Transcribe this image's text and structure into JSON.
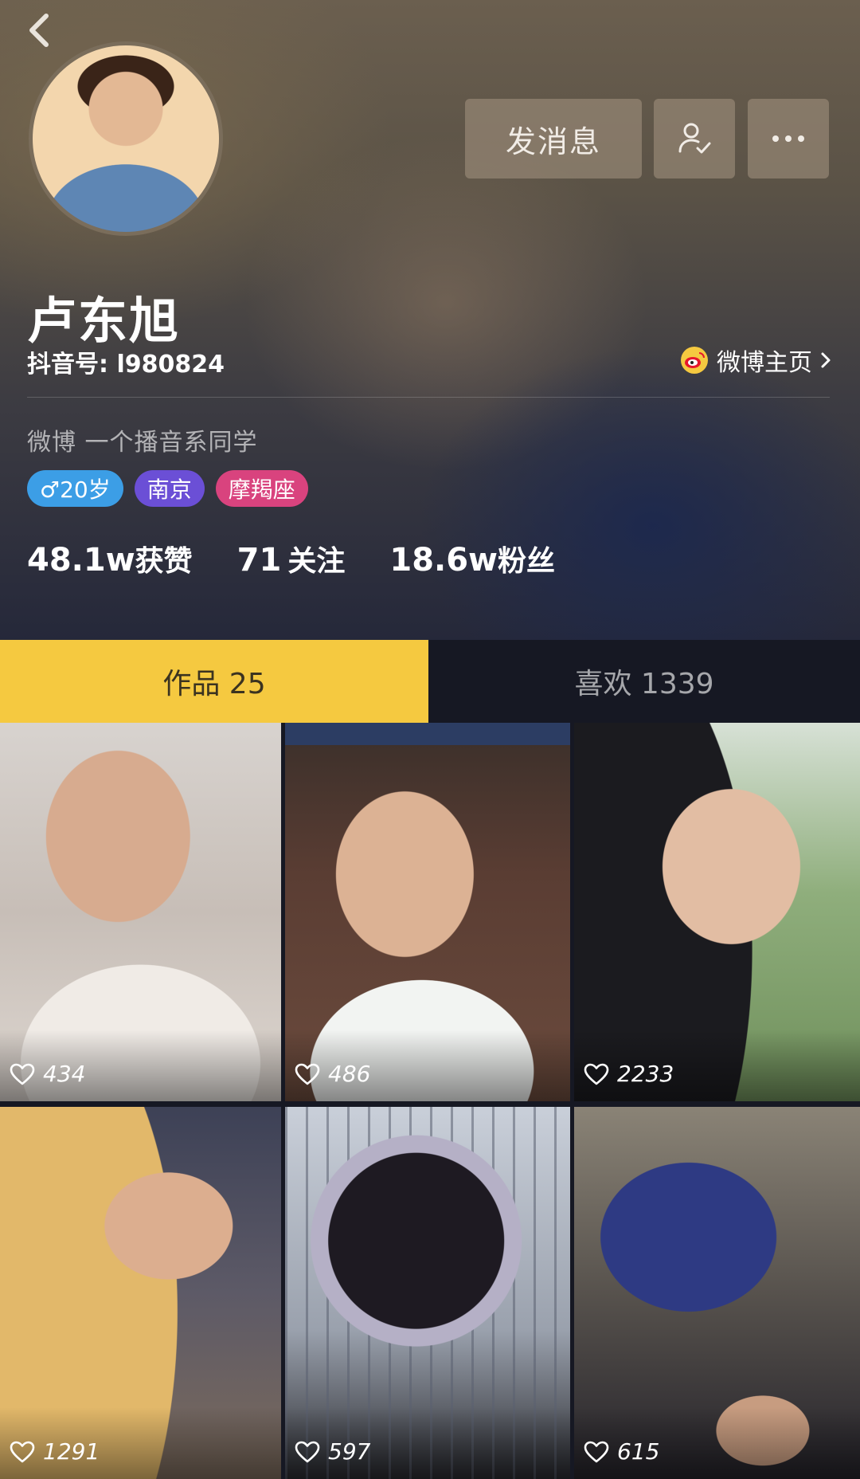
{
  "header": {
    "back_icon": "chevron-left-icon",
    "buttons": {
      "message_label": "发消息",
      "follow_icon": "user-check-icon",
      "more_icon": "more-horizontal-icon"
    },
    "name": "卢东旭",
    "douyin_id": "抖音号: l980824",
    "weibo": {
      "icon": "weibo-icon",
      "label": "微博主页"
    },
    "bio": "微博 一个播音系同学",
    "tags": {
      "age": "♂20岁",
      "city": "南京",
      "sign": "摩羯座"
    },
    "stats": {
      "likes_num": "48.1w",
      "likes_label": "获赞",
      "following_num": "71",
      "following_label": "关注",
      "fans_num": "18.6w",
      "fans_label": "粉丝"
    }
  },
  "tabs": {
    "works": "作品 25",
    "likes": "喜欢 1339",
    "active": "works"
  },
  "grid": {
    "tiles": [
      {
        "likes": "434"
      },
      {
        "likes": "486"
      },
      {
        "likes": "2233"
      },
      {
        "likes": "1291"
      },
      {
        "likes": "597"
      },
      {
        "likes": "615"
      }
    ]
  },
  "colors": {
    "accent_tab": "#f5c940",
    "background": "#161823",
    "tag_age": "#3c9ee6",
    "tag_city": "#6b4fd6",
    "tag_sign": "#d9437e"
  }
}
